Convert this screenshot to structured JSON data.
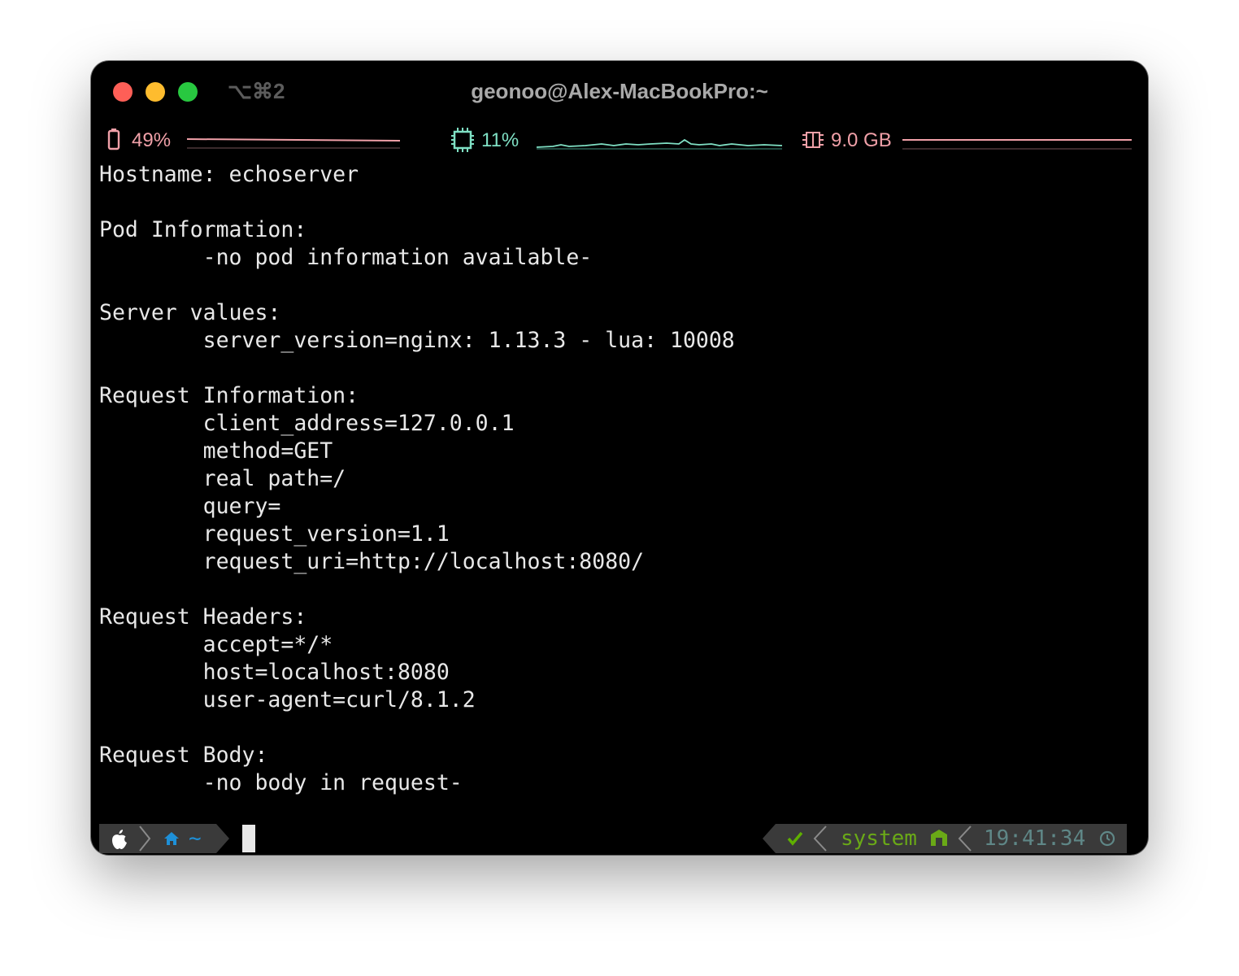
{
  "window": {
    "shortcut": "⌥⌘2",
    "title": "geonoo@Alex-MacBookPro:~"
  },
  "status": {
    "battery": {
      "icon": "battery-icon",
      "value": "49%",
      "color": "#f0a0a8"
    },
    "cpu": {
      "icon": "cpu-icon",
      "value": "11%",
      "color": "#7fe0c4"
    },
    "memory": {
      "icon": "memory-icon",
      "value": "9.0 GB",
      "color": "#f0a0a8"
    }
  },
  "output": {
    "lines": [
      "Hostname: echoserver",
      "",
      "Pod Information:",
      "        -no pod information available-",
      "",
      "Server values:",
      "        server_version=nginx: 1.13.3 - lua: 10008",
      "",
      "Request Information:",
      "        client_address=127.0.0.1",
      "        method=GET",
      "        real path=/",
      "        query=",
      "        request_version=1.1",
      "        request_uri=http://localhost:8080/",
      "",
      "Request Headers:",
      "        accept=*/*",
      "        host=localhost:8080",
      "        user-agent=curl/8.1.2",
      "",
      "Request Body:",
      "        -no body in request-"
    ]
  },
  "prompt": {
    "left": {
      "os_icon": "apple-icon",
      "dir_icon": "home-icon",
      "dir": "~"
    },
    "right": {
      "status_icon": "check-icon",
      "env": "system",
      "env_icon": "node-icon",
      "time": "19:41:34",
      "time_icon": "clock-icon"
    }
  },
  "colors": {
    "segment_bg": "#3a3a3a",
    "dir_color": "#1e90d8",
    "check_color": "#5faf00",
    "env_color": "#6aa917",
    "time_color": "#5f8787"
  }
}
